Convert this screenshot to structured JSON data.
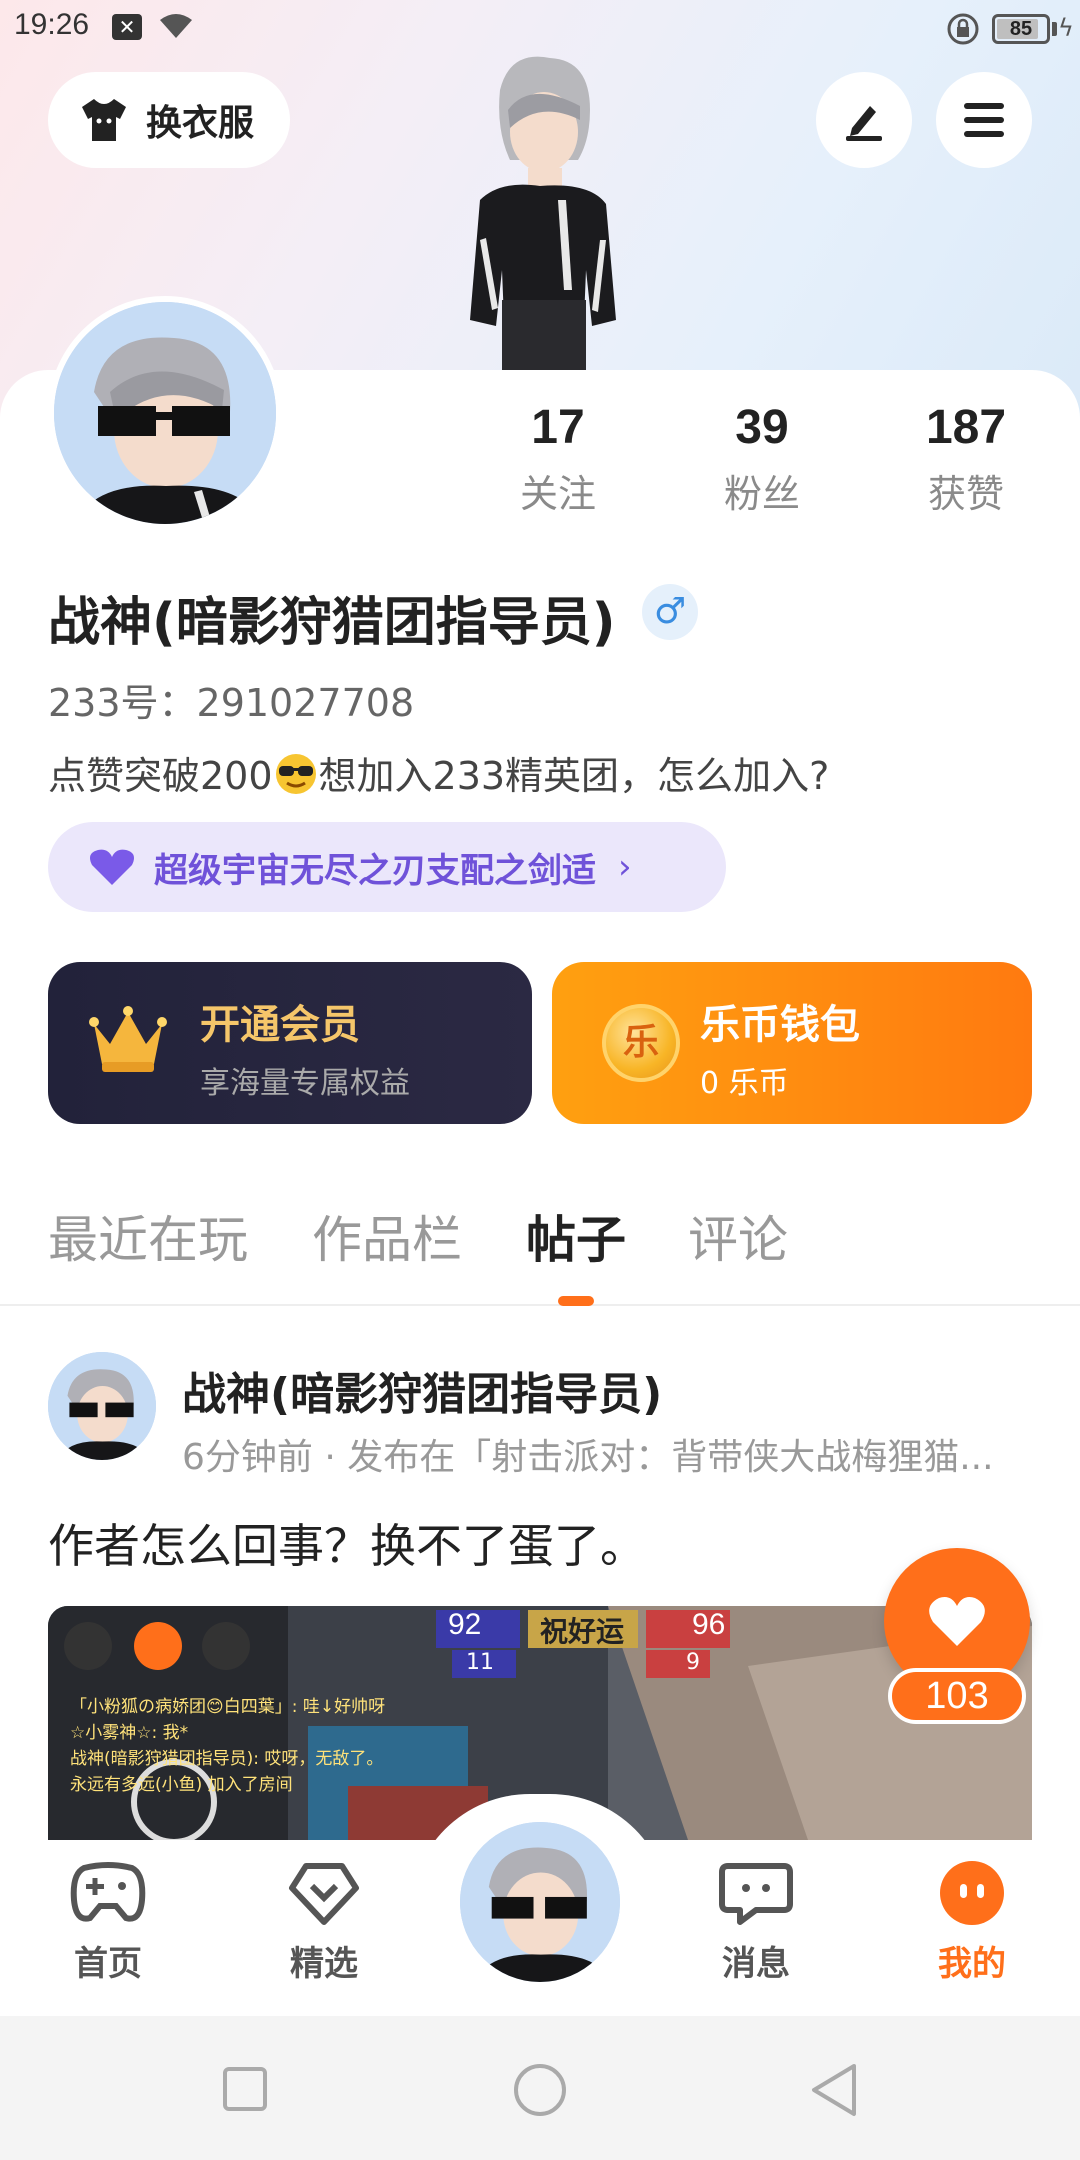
{
  "status_bar": {
    "time": "19:26",
    "battery": "85",
    "battery_level": 0.85
  },
  "header": {
    "dress_button_label": "换衣服",
    "edit_icon": "pencil-icon",
    "menu_icon": "menu-icon"
  },
  "profile": {
    "stats": [
      {
        "value": "17",
        "label": "关注"
      },
      {
        "value": "39",
        "label": "粉丝"
      },
      {
        "value": "187",
        "label": "获赞"
      }
    ],
    "username": "战神(暗影狩猎团指导员)",
    "gender_symbol": "♂",
    "uid": "233号：291027708",
    "bio_before": "点赞突破200",
    "bio_after": "想加入233精英团，怎么加入?",
    "tag_label": "超级宇宙无尽之刃支配之剑适",
    "tag_chevron": "›"
  },
  "vip_card": {
    "title": "开通会员",
    "subtitle": "享海量专属权益"
  },
  "wallet_card": {
    "coin_glyph": "乐",
    "title": "乐币钱包",
    "subtitle": "0 乐币"
  },
  "tabs": [
    {
      "label": "最近在玩",
      "active": false
    },
    {
      "label": "作品栏",
      "active": false
    },
    {
      "label": "帖子",
      "active": true
    },
    {
      "label": "评论",
      "active": false
    }
  ],
  "post": {
    "author": "战神(暗影狩猎团指导员)",
    "meta": "6分钟前 · 发布在「射击派对：背带侠大战梅狸猫...",
    "text": "作者怎么回事？换不了蛋了。",
    "like_count": "103",
    "image": {
      "score_left": "92",
      "score_right": "96",
      "banner": "祝好运",
      "players_left": "11",
      "players_right": "9",
      "chat_lines": [
        "「小粉狐の病娇团😊白四葉」: 哇↓好帅呀",
        "☆小雾神☆: 我*",
        "战神(暗影狩猎团指导员): 哎呀，无敌了。",
        "永远有多远(小鱼) 加入了房间"
      ]
    }
  },
  "bottom_nav": [
    {
      "label": "首页",
      "icon": "gamepad-icon",
      "active": false
    },
    {
      "label": "精选",
      "icon": "heart-diamond-icon",
      "active": false
    },
    {
      "label": "消息",
      "icon": "chat-icon",
      "active": false
    },
    {
      "label": "我的",
      "icon": "profile-face-icon",
      "active": true
    }
  ],
  "colors": {
    "accent": "#ff6f1a",
    "tag_purple": "#6f52d9",
    "vip_gold": "#f5c66a"
  }
}
